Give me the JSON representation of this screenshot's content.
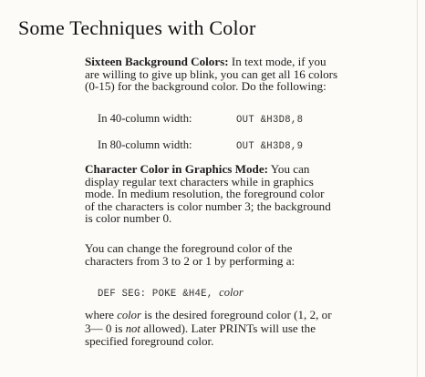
{
  "heading": "Some Techniques with Color",
  "p1": {
    "lead": "Sixteen Background Colors:",
    "l1_rest": "  In text mode, if you",
    "l2": "are willing to give up blink, you can get all 16 colors",
    "l3": "(0-15) for the background color. Do the following:"
  },
  "code_rows": [
    {
      "label": "In 40-column width:",
      "code": "OUT &H3D8,8"
    },
    {
      "label": "In 80-column width:",
      "code": "OUT &H3D8,9"
    }
  ],
  "p2": {
    "lead": "Character Color in Graphics Mode:",
    "l1_rest": "  You can",
    "l2": "display regular text characters while in graphics",
    "l3": "mode. In medium resolution, the foreground color",
    "l4": "of the characters is color number 3; the background",
    "l5": "is color number 0."
  },
  "p3": {
    "l1": "You can change the foreground color of the",
    "l2": "characters from 3 to 2 or 1 by performing a:"
  },
  "code_line": {
    "code": "DEF SEG: POKE &H4E,",
    "var": "color"
  },
  "p4": {
    "l1_a": "where ",
    "l1_var": "color",
    "l1_b": " is the desired foreground color (1, 2, or",
    "l2_a": "3— 0 is ",
    "l2_not": "not",
    "l2_b": " allowed). Later PRINTs will use the",
    "l3": "specified foreground color."
  }
}
